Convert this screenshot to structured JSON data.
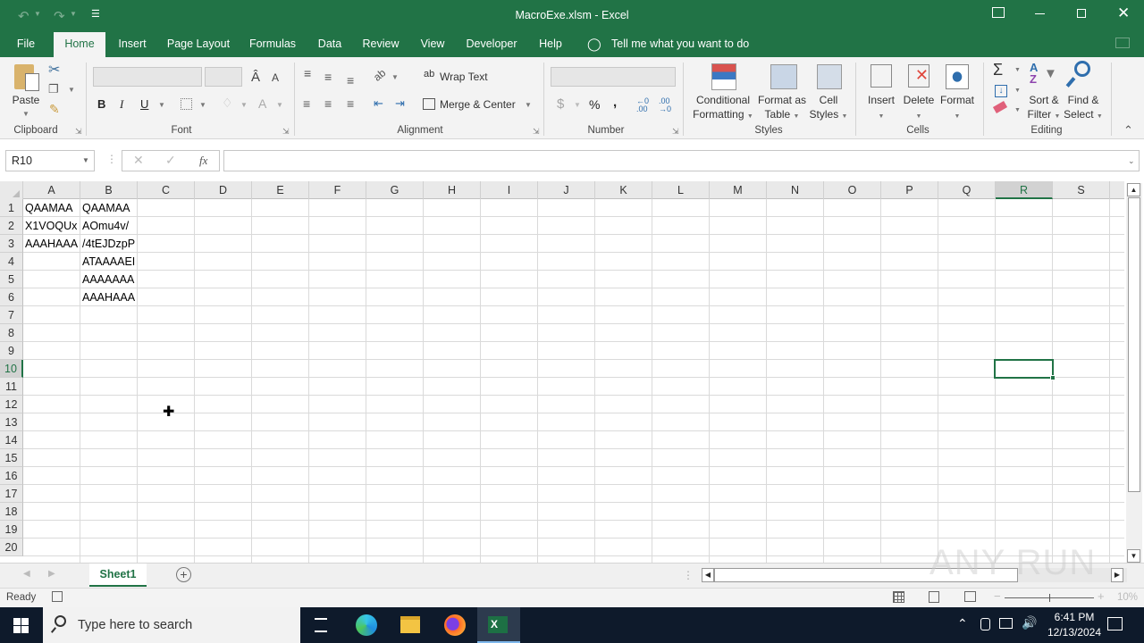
{
  "window": {
    "title": "MacroExe.xlsm  -  Excel",
    "controls": [
      "ribbon-display-options",
      "minimize",
      "restore",
      "close"
    ]
  },
  "quick_access": {
    "undo": "undo-icon",
    "redo": "redo-icon",
    "customize": "customize-icon"
  },
  "ribbon_tabs": [
    {
      "label": "File",
      "active": false
    },
    {
      "label": "Home",
      "active": true
    },
    {
      "label": "Insert",
      "active": false
    },
    {
      "label": "Page Layout",
      "active": false
    },
    {
      "label": "Formulas",
      "active": false
    },
    {
      "label": "Data",
      "active": false
    },
    {
      "label": "Review",
      "active": false
    },
    {
      "label": "View",
      "active": false
    },
    {
      "label": "Developer",
      "active": false
    },
    {
      "label": "Help",
      "active": false
    }
  ],
  "tell_me": "Tell me what you want to do",
  "ribbon": {
    "clipboard": {
      "label": "Clipboard",
      "paste": "Paste"
    },
    "font": {
      "label": "Font",
      "font_name": "",
      "font_size": "",
      "bold": "B",
      "italic": "I",
      "underline": "U"
    },
    "alignment": {
      "label": "Alignment",
      "wrap_text": "Wrap Text",
      "merge_center": "Merge & Center"
    },
    "number": {
      "label": "Number",
      "format": "",
      "currency": "$",
      "percent": "%",
      "comma": ","
    },
    "styles": {
      "label": "Styles",
      "conditional_1": "Conditional",
      "conditional_2": "Formatting",
      "format_table_1": "Format as",
      "format_table_2": "Table",
      "cell_styles_1": "Cell",
      "cell_styles_2": "Styles"
    },
    "cells": {
      "label": "Cells",
      "insert": "Insert",
      "delete": "Delete",
      "format": "Format"
    },
    "editing": {
      "label": "Editing",
      "sort_1": "Sort &",
      "sort_2": "Filter",
      "find_1": "Find &",
      "find_2": "Select"
    }
  },
  "formula_bar": {
    "name_box": "R10",
    "fx": "fx",
    "formula": ""
  },
  "columns": [
    "A",
    "B",
    "C",
    "D",
    "E",
    "F",
    "G",
    "H",
    "I",
    "J",
    "K",
    "L",
    "M",
    "N",
    "O",
    "P",
    "Q",
    "R",
    "S"
  ],
  "selected_column": "R",
  "rows": [
    "1",
    "2",
    "3",
    "4",
    "5",
    "6",
    "7",
    "8",
    "9",
    "10",
    "11",
    "12",
    "13",
    "14",
    "15",
    "16",
    "17",
    "18",
    "19",
    "20"
  ],
  "selected_row": "10",
  "cells": [
    {
      "ref": "A1",
      "value": "QAAMAA"
    },
    {
      "ref": "B1",
      "value": "QAAMAA"
    },
    {
      "ref": "A2",
      "value": "X1VOQUx"
    },
    {
      "ref": "B2",
      "value": "AOmu4v/"
    },
    {
      "ref": "A3",
      "value": "AAAHAAA"
    },
    {
      "ref": "B3",
      "value": "/4tEJDzpP"
    },
    {
      "ref": "B4",
      "value": "ATAAAAEI"
    },
    {
      "ref": "B5",
      "value": "AAAAAAA"
    },
    {
      "ref": "B6",
      "value": "AAAHAAA"
    }
  ],
  "sheets": [
    {
      "name": "Sheet1",
      "active": true
    }
  ],
  "status": {
    "mode": "Ready",
    "zoom": "10%"
  },
  "taskbar": {
    "search_placeholder": "Type here to search",
    "time": "6:41 PM",
    "date": "12/13/2024",
    "apps": [
      "task-view",
      "edge",
      "file-explorer",
      "firefox",
      "excel"
    ]
  },
  "watermark": "ANY RUN"
}
